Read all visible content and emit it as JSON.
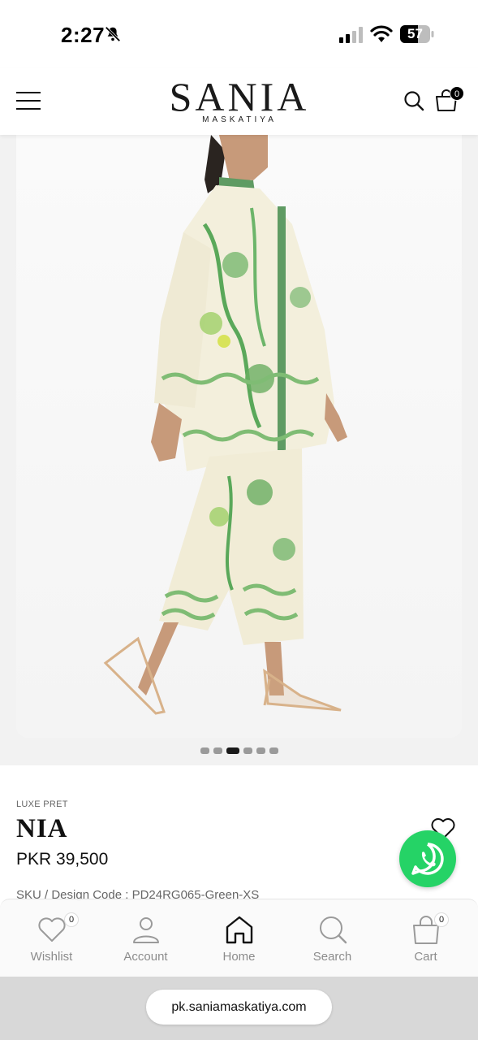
{
  "status_bar": {
    "time": "2:27",
    "battery": "57",
    "icons": [
      "bell-off-icon",
      "cellular-signal-icon",
      "wifi-icon",
      "battery-icon"
    ]
  },
  "header": {
    "logo_main": "SANIA",
    "logo_sub": "MASKATIYA",
    "cart_count": "0",
    "icons": [
      "hamburger-menu-icon",
      "search-icon",
      "shopping-bag-icon"
    ]
  },
  "gallery": {
    "image_count": 6,
    "active_index": 2
  },
  "product": {
    "category": "LUXE PRET",
    "name": "NIA",
    "price": "PKR 39,500",
    "sku": "SKU / Design Code : PD24RG065-Green-XS"
  },
  "bottom_nav": {
    "items": [
      {
        "label": "Wishlist",
        "icon": "heart-icon",
        "badge": "0"
      },
      {
        "label": "Account",
        "icon": "user-icon"
      },
      {
        "label": "Home",
        "icon": "home-icon"
      },
      {
        "label": "Search",
        "icon": "search-icon"
      },
      {
        "label": "Cart",
        "icon": "bag-icon",
        "badge": "0"
      }
    ]
  },
  "browser": {
    "url": "pk.saniamaskatiya.com"
  },
  "colors": {
    "whatsapp": "#25d366",
    "print_green": "#5aa85a",
    "fabric_cream": "#f3efdc"
  }
}
